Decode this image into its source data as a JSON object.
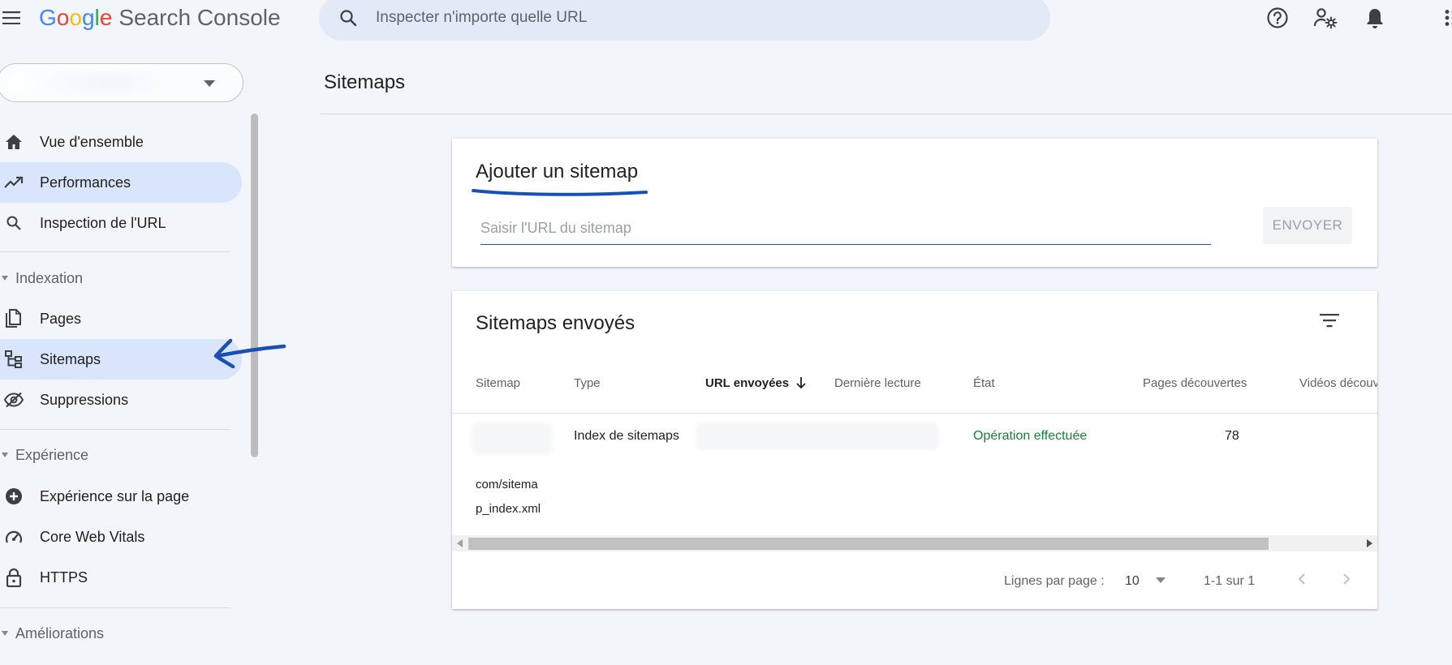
{
  "header": {
    "logo_google": [
      "G",
      "o",
      "o",
      "g",
      "l",
      "e"
    ],
    "product": "Search Console",
    "search_placeholder": "Inspecter n'importe quelle URL",
    "icons": [
      "menu-icon",
      "search-icon",
      "help-icon",
      "settings-icon",
      "notifications-icon",
      "apps-icon"
    ]
  },
  "sidebar": {
    "property_value": "",
    "items_top": [
      {
        "label": "Vue d'ensemble",
        "icon": "home-icon"
      },
      {
        "label": "Performances",
        "icon": "trending-up-icon",
        "active": true
      },
      {
        "label": "Inspection de l'URL",
        "icon": "search-icon"
      }
    ],
    "sections": [
      {
        "label": "Indexation",
        "items": [
          {
            "label": "Pages",
            "icon": "pages-icon"
          },
          {
            "label": "Sitemaps",
            "icon": "sitemap-icon",
            "active": true
          },
          {
            "label": "Suppressions",
            "icon": "visibility-off-icon"
          }
        ]
      },
      {
        "label": "Expérience",
        "items": [
          {
            "label": "Expérience sur la page",
            "icon": "add-circle-icon"
          },
          {
            "label": "Core Web Vitals",
            "icon": "speed-icon"
          },
          {
            "label": "HTTPS",
            "icon": "lock-icon"
          }
        ]
      },
      {
        "label": "Améliorations",
        "items": []
      }
    ]
  },
  "main": {
    "page_title": "Sitemaps",
    "add_sitemap": {
      "title": "Ajouter un sitemap",
      "input_placeholder": "Saisir l'URL du sitemap",
      "submit_label": "ENVOYER"
    },
    "submitted": {
      "title": "Sitemaps envoyés",
      "columns": [
        "Sitemap",
        "Type",
        "URL envoyées",
        "Dernière lecture",
        "État",
        "Pages découvertes",
        "Vidéos découv"
      ],
      "sorted_column": "URL envoyées",
      "rows": [
        {
          "sitemap_line1": "com/sitema",
          "sitemap_line2": "p_index.xml",
          "type": "Index de sitemaps",
          "status": "Opération effectuée",
          "pages": "78"
        }
      ]
    },
    "pagination": {
      "rows_per_page_label": "Lignes par page :",
      "rows_per_page": "10",
      "range": "1-1 sur 1"
    }
  },
  "colors": {
    "accent": "#1a56c4",
    "nav_active": "#d9e5fb",
    "search_bg": "#e3eaf7",
    "success": "#188038",
    "annotation": "#1a4fb8"
  }
}
